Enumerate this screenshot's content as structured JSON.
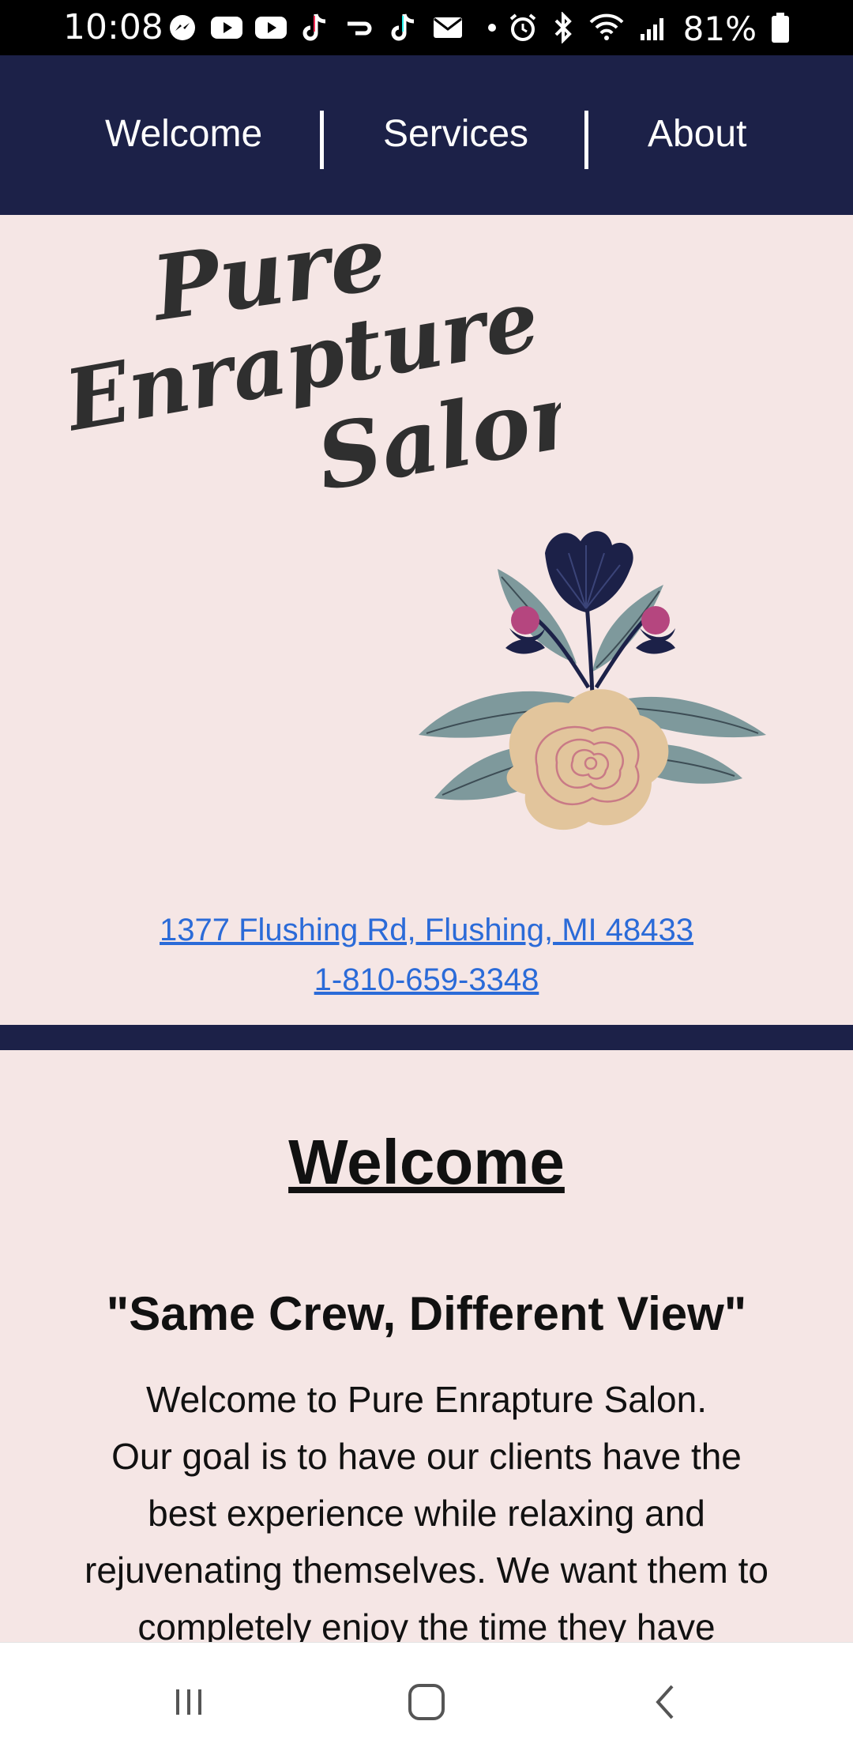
{
  "status_bar": {
    "time": "10:08",
    "battery": "81%",
    "left_icons": [
      "messenger-icon",
      "youtube-icon",
      "youtube-icon",
      "tiktok-icon",
      "cast-icon",
      "tiktok-icon",
      "mail-icon",
      "dot-icon"
    ],
    "right_icons": [
      "alarm-icon",
      "bluetooth-icon",
      "wifi-icon",
      "signal-icon",
      "battery-icon"
    ]
  },
  "nav": {
    "items": [
      "Welcome",
      "Services",
      "About"
    ]
  },
  "logo": {
    "line1": "Pure",
    "line2": "Enrapture",
    "line3": "Salon"
  },
  "contact": {
    "address": "1377 Flushing Rd, Flushing, MI 48433",
    "phone": "1-810-659-3348"
  },
  "welcome": {
    "title": "Welcome",
    "tagline": "\"Same Crew, Different View\"",
    "paragraph1": "Welcome to Pure Enrapture Salon.",
    "paragraph2": "Our goal is to have our clients have the best experience while relaxing and rejuvenating themselves. We want them to completely enjoy the time they have"
  },
  "colors": {
    "navy": "#1c2148",
    "background": "#f5e6e5",
    "link": "#2b6bd8"
  },
  "android_nav": [
    "recent-apps-icon",
    "home-icon",
    "back-icon"
  ]
}
